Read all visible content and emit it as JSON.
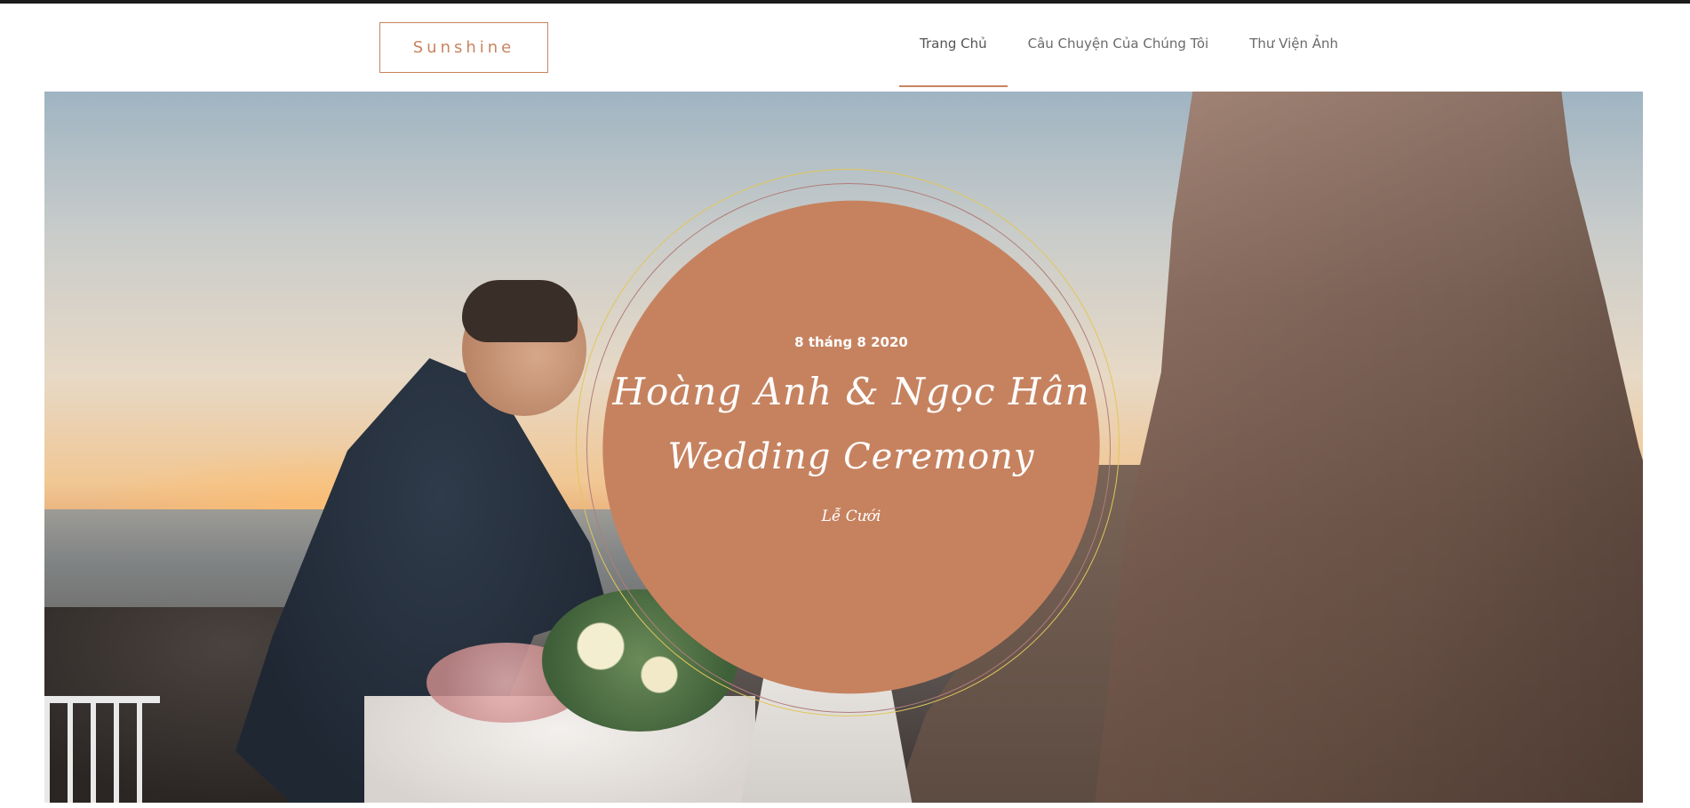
{
  "header": {
    "logo": "Sunshine",
    "nav": [
      {
        "label": "Trang Chủ",
        "active": true
      },
      {
        "label": "Câu Chuyện Của Chúng Tôi",
        "active": false
      },
      {
        "label": "Thư Viện Ảnh",
        "active": false
      }
    ]
  },
  "hero": {
    "date": "8 tháng 8 2020",
    "names": "Hoàng Anh & Ngọc Hân",
    "title": "Wedding Ceremony",
    "subtitle": "Lễ Cưới"
  },
  "colors": {
    "accent": "#c6825f",
    "ring_gold": "#e1c65a",
    "ring_rose": "#b07d7a"
  }
}
